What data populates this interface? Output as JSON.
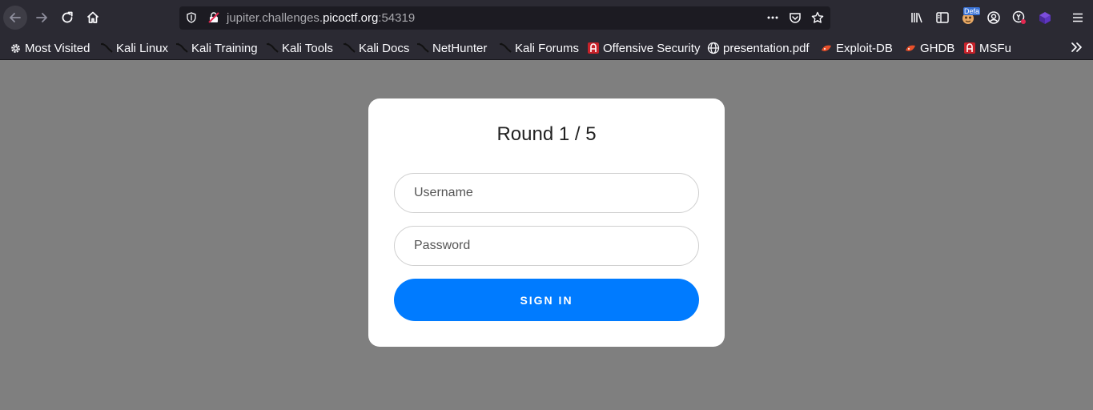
{
  "browser": {
    "url": {
      "prefix": "jupiter.challenges.",
      "domain": "picoctf.org",
      "port": ":54319"
    },
    "extension_badge": "Defa",
    "icons": [
      "back-arrow-icon",
      "forward-arrow-icon",
      "reload-icon",
      "home-icon",
      "shield-icon",
      "insecure-lock-icon",
      "more-icon",
      "pocket-icon",
      "star-icon",
      "library-icon",
      "sidebar-icon",
      "extension-icon",
      "account-icon",
      "extension-x-icon",
      "extension-cube-icon",
      "hamburger-menu-icon"
    ]
  },
  "bookmarks": [
    {
      "label": "Most Visited",
      "icon": "gear-icon"
    },
    {
      "label": "Kali Linux",
      "icon": "kali-dragon-icon"
    },
    {
      "label": "Kali Training",
      "icon": "kali-dragon-icon"
    },
    {
      "label": "Kali Tools",
      "icon": "kali-dragon-icon"
    },
    {
      "label": "Kali Docs",
      "icon": "kali-dragon-icon"
    },
    {
      "label": "NetHunter",
      "icon": "kali-dragon-icon"
    },
    {
      "label": "Kali Forums",
      "icon": "kali-dragon-icon"
    },
    {
      "label": "Offensive Security",
      "icon": "offsec-icon"
    },
    {
      "label": "presentation.pdf",
      "icon": "globe-icon"
    },
    {
      "label": "Exploit-DB",
      "icon": "exploitdb-icon"
    },
    {
      "label": "GHDB",
      "icon": "exploitdb-icon"
    },
    {
      "label": "MSFu",
      "icon": "offsec-icon"
    }
  ],
  "page": {
    "title": "Round 1 / 5",
    "username_placeholder": "Username",
    "password_placeholder": "Password",
    "signin_label": "SIGN IN"
  },
  "colors": {
    "page_bg": "#7f7f7f",
    "toolbar_bg": "#2b2a33",
    "urlbar_bg": "#1c1b22",
    "accent_button": "#007bff",
    "card_bg": "#ffffff"
  }
}
